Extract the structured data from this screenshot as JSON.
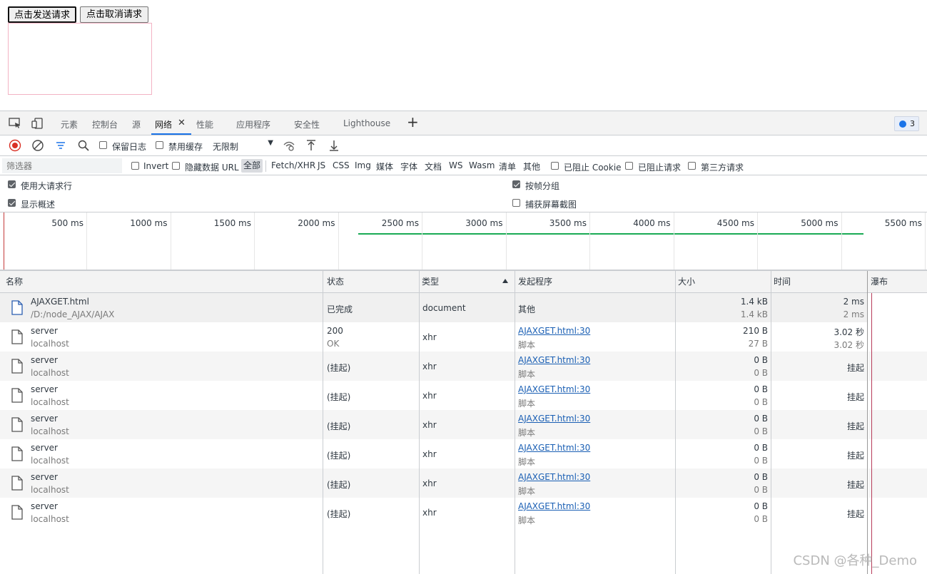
{
  "page": {
    "send_button": "点击发送请求",
    "cancel_button": "点击取消请求"
  },
  "devtools": {
    "tabs": [
      "元素",
      "控制台",
      "源",
      "网络",
      "性能",
      "应用程序",
      "安全性",
      "Lighthouse"
    ],
    "active_tab": "网络",
    "issues_count": "3",
    "toolbar": {
      "preserve_log": "保留日志",
      "disable_cache": "禁用缓存",
      "throttling": "无限制"
    },
    "filter": {
      "placeholder": "筛选器",
      "invert": "Invert",
      "hide_data_urls": "隐藏数据 URL",
      "types": [
        "全部",
        "Fetch/XHR",
        "JS",
        "CSS",
        "Img",
        "媒体",
        "字体",
        "文档",
        "WS",
        "Wasm",
        "清单",
        "其他"
      ],
      "selected_type": "全部",
      "blocked_cookies": "已阻止 Cookie",
      "blocked_requests": "已阻止请求",
      "third_party": "第三方请求"
    },
    "options": {
      "large_rows": "使用大请求行",
      "large_rows_checked": true,
      "group_by_frame": "按帧分组",
      "group_by_frame_checked": true,
      "show_overview": "显示概述",
      "show_overview_checked": true,
      "capture_screenshots": "捕获屏幕截图",
      "capture_screenshots_checked": false
    },
    "overview_ticks": [
      "500 ms",
      "1000 ms",
      "1500 ms",
      "2000 ms",
      "2500 ms",
      "3000 ms",
      "3500 ms",
      "4000 ms",
      "4500 ms",
      "5000 ms",
      "5500 ms"
    ],
    "columns": [
      "名称",
      "状态",
      "类型",
      "发起程序",
      "大小",
      "时间",
      "瀑布"
    ],
    "rows": [
      {
        "name": "AJAXGET.html",
        "path": "/D:/node_AJAX/AJAX",
        "status": "已完成",
        "status2": "",
        "type": "document",
        "initiator": "其他",
        "initiator_sub": "",
        "initiator_link": false,
        "size": "1.4 kB",
        "size2": "1.4 kB",
        "time": "2 ms",
        "time2": "2 ms"
      },
      {
        "name": "server",
        "path": "localhost",
        "status": "200",
        "status2": "OK",
        "type": "xhr",
        "initiator": "AJAXGET.html:30",
        "initiator_sub": "脚本",
        "initiator_link": true,
        "size": "210 B",
        "size2": "27 B",
        "time": "3.02 秒",
        "time2": "3.02 秒"
      },
      {
        "name": "server",
        "path": "localhost",
        "status": "(挂起)",
        "status2": "",
        "type": "xhr",
        "initiator": "AJAXGET.html:30",
        "initiator_sub": "脚本",
        "initiator_link": true,
        "size": "0 B",
        "size2": "0 B",
        "time": "挂起",
        "time2": ""
      },
      {
        "name": "server",
        "path": "localhost",
        "status": "(挂起)",
        "status2": "",
        "type": "xhr",
        "initiator": "AJAXGET.html:30",
        "initiator_sub": "脚本",
        "initiator_link": true,
        "size": "0 B",
        "size2": "0 B",
        "time": "挂起",
        "time2": ""
      },
      {
        "name": "server",
        "path": "localhost",
        "status": "(挂起)",
        "status2": "",
        "type": "xhr",
        "initiator": "AJAXGET.html:30",
        "initiator_sub": "脚本",
        "initiator_link": true,
        "size": "0 B",
        "size2": "0 B",
        "time": "挂起",
        "time2": ""
      },
      {
        "name": "server",
        "path": "localhost",
        "status": "(挂起)",
        "status2": "",
        "type": "xhr",
        "initiator": "AJAXGET.html:30",
        "initiator_sub": "脚本",
        "initiator_link": true,
        "size": "0 B",
        "size2": "0 B",
        "time": "挂起",
        "time2": ""
      },
      {
        "name": "server",
        "path": "localhost",
        "status": "(挂起)",
        "status2": "",
        "type": "xhr",
        "initiator": "AJAXGET.html:30",
        "initiator_sub": "脚本",
        "initiator_link": true,
        "size": "0 B",
        "size2": "0 B",
        "time": "挂起",
        "time2": ""
      },
      {
        "name": "server",
        "path": "localhost",
        "status": "(挂起)",
        "status2": "",
        "type": "xhr",
        "initiator": "AJAXGET.html:30",
        "initiator_sub": "脚本",
        "initiator_link": true,
        "size": "0 B",
        "size2": "0 B",
        "time": "挂起",
        "time2": ""
      }
    ],
    "watermark": "CSDN @各种_Demo",
    "colors": {
      "accent": "#1a73e8",
      "overview_line": "#1aaa55",
      "link": "#1a5fb4"
    }
  }
}
